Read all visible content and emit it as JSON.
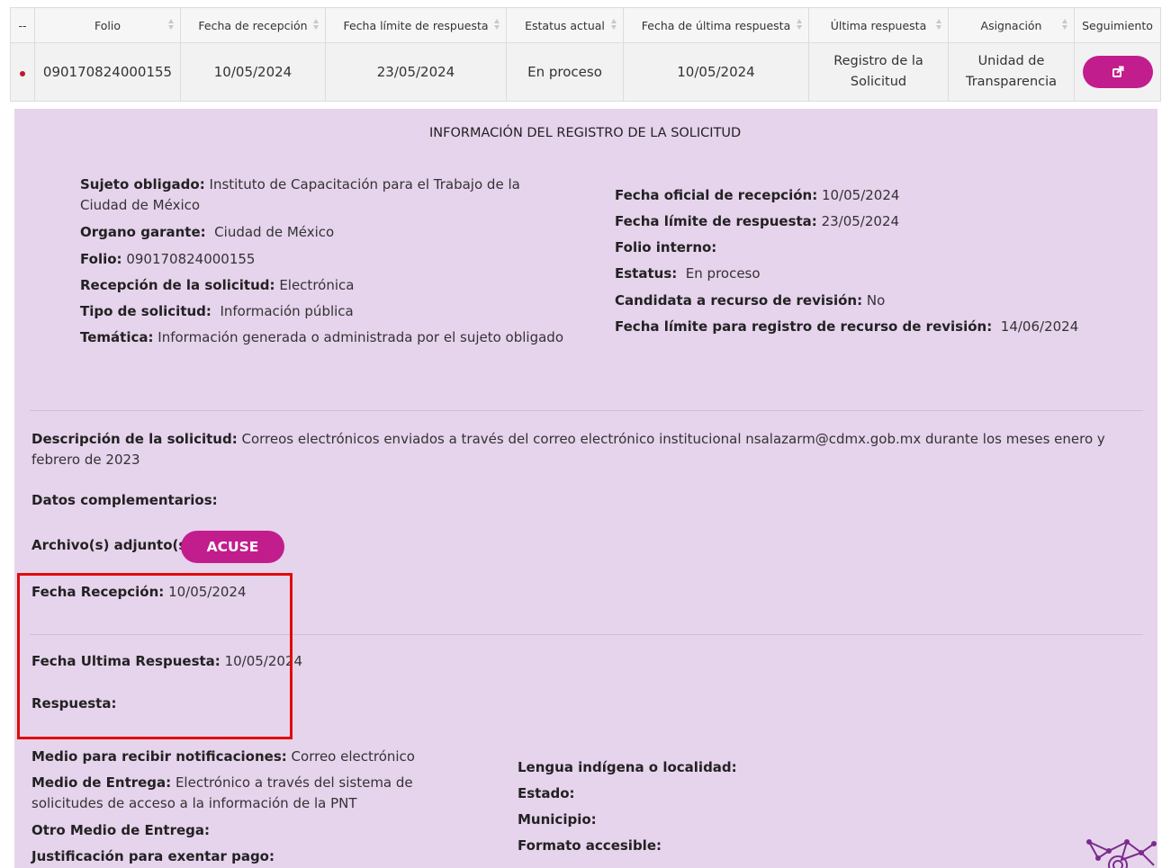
{
  "table": {
    "headers": [
      "--",
      "Folio",
      "Fecha de recepción",
      "Fecha límite de respuesta",
      "Estatus actual",
      "Fecha de última respuesta",
      "Última respuesta",
      "Asignación",
      "Seguimiento"
    ],
    "row": {
      "folio": "090170824000155",
      "fecha_recepcion": "10/05/2024",
      "fecha_limite": "23/05/2024",
      "estatus": "En proceso",
      "fecha_ultima": "10/05/2024",
      "ultima_respuesta_l1": "Registro de la",
      "ultima_respuesta_l2": "Solicitud",
      "asignacion_l1": "Unidad de",
      "asignacion_l2": "Transparencia",
      "seguimiento_icon": "external-link-icon"
    }
  },
  "panel": {
    "title": "INFORMACIÓN DEL REGISTRO DE LA SOLICITUD",
    "left": [
      {
        "label": "Sujeto obligado:",
        "value": "Instituto de Capacitación para el Trabajo de la Ciudad de México"
      },
      {
        "label": "Organo garante:",
        "value": "Ciudad de México"
      },
      {
        "label": "Folio:",
        "value": "090170824000155"
      },
      {
        "label": "Recepción de la solicitud:",
        "value": "Electrónica"
      },
      {
        "label": "Tipo de solicitud:",
        "value": "Información pública"
      },
      {
        "label": "Temática:",
        "value": "Información generada o administrada por el sujeto obligado"
      }
    ],
    "right": [
      {
        "label": "Fecha oficial de recepción:",
        "value": "10/05/2024"
      },
      {
        "label": "Fecha límite de respuesta:",
        "value": "23/05/2024"
      },
      {
        "label": "Folio interno:",
        "value": ""
      },
      {
        "label": "Estatus:",
        "value": "En proceso"
      },
      {
        "label": "Candidata a recurso de revisión:",
        "value": "No"
      },
      {
        "label": "Fecha límite para registro de recurso de revisión:",
        "value": "14/06/2024"
      }
    ],
    "descripcion": {
      "label": "Descripción de la solicitud:",
      "value": "Correos electrónicos enviados a través del correo electrónico institucional nsalazarm@cdmx.gob.mx durante los meses enero y febrero de 2023"
    },
    "datos_complementarios": {
      "label": "Datos complementarios:",
      "value": ""
    },
    "archivos": {
      "label": "Archivo(s) adjunto(s):",
      "button": "ACUSE"
    },
    "fecha_recepcion": {
      "label": "Fecha Recepción:",
      "value": "10/05/2024"
    },
    "fecha_ultima_respuesta": {
      "label": "Fecha Ultima Respuesta:",
      "value": "10/05/2024"
    },
    "respuesta": {
      "label": "Respuesta:",
      "value": ""
    },
    "bottom_left": [
      {
        "label": "Medio para recibir notificaciones:",
        "value": "Correo electrónico"
      },
      {
        "label": "Medio de Entrega:",
        "value": "Electrónico a través del sistema de solicitudes de acceso a la información de la PNT"
      },
      {
        "label": "Otro Medio de Entrega:",
        "value": ""
      },
      {
        "label": "Justificación para exentar pago:",
        "value": ""
      }
    ],
    "bottom_right": [
      {
        "label": "Lengua indígena o localidad:",
        "value": ""
      },
      {
        "label": "Estado:",
        "value": ""
      },
      {
        "label": "Municipio:",
        "value": ""
      },
      {
        "label": "Formato accesible:",
        "value": ""
      }
    ]
  },
  "colors": {
    "accent": "#c21d8d",
    "panel_bg": "#e6d3ec",
    "highlight_box": "#e00b0b",
    "status_dot": "#c0172b"
  }
}
